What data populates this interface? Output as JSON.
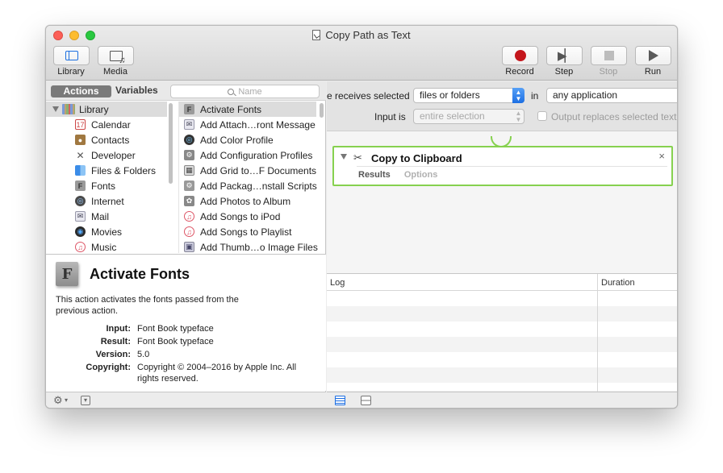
{
  "window": {
    "title": "Copy Path as Text"
  },
  "toolbar": {
    "library": "Library",
    "media": "Media",
    "record": "Record",
    "step": "Step",
    "stop": "Stop",
    "run": "Run"
  },
  "library_header": {
    "actions_tab": "Actions",
    "variables_tab": "Variables",
    "search_placeholder": "Name"
  },
  "categories": [
    {
      "label": "Library",
      "icon": "library-icon"
    },
    {
      "label": "Calendar",
      "icon": "calendar-icon"
    },
    {
      "label": "Contacts",
      "icon": "contacts-icon"
    },
    {
      "label": "Developer",
      "icon": "developer-icon"
    },
    {
      "label": "Files & Folders",
      "icon": "finder-icon"
    },
    {
      "label": "Fonts",
      "icon": "fonts-icon"
    },
    {
      "label": "Internet",
      "icon": "internet-icon"
    },
    {
      "label": "Mail",
      "icon": "mail-icon"
    },
    {
      "label": "Movies",
      "icon": "movies-icon"
    },
    {
      "label": "Music",
      "icon": "music-icon"
    }
  ],
  "actions": [
    {
      "label": "Activate Fonts",
      "icon": "font-book-icon",
      "selected": true
    },
    {
      "label": "Add Attach…ront Message",
      "icon": "mail-icon"
    },
    {
      "label": "Add Color Profile",
      "icon": "color-profile-icon"
    },
    {
      "label": "Add Configuration Profiles",
      "icon": "configurator-icon"
    },
    {
      "label": "Add Grid to…F Documents",
      "icon": "pdf-grid-icon"
    },
    {
      "label": "Add Packag…nstall Scripts",
      "icon": "package-icon"
    },
    {
      "label": "Add Photos to Album",
      "icon": "photos-icon"
    },
    {
      "label": "Add Songs to iPod",
      "icon": "itunes-icon"
    },
    {
      "label": "Add Songs to Playlist",
      "icon": "itunes-icon"
    },
    {
      "label": "Add Thumb…o Image Files",
      "icon": "preview-icon"
    }
  ],
  "description": {
    "title": "Activate Fonts",
    "icon_letter": "F",
    "text": "This action activates the fonts passed from the previous action.",
    "rows": [
      {
        "key": "Input:",
        "value": "Font Book typeface"
      },
      {
        "key": "Result:",
        "value": "Font Book typeface"
      },
      {
        "key": "Version:",
        "value": "5.0"
      },
      {
        "key": "Copyright:",
        "value": "Copyright © 2004–2016 by Apple Inc. All rights reserved."
      }
    ]
  },
  "workflow": {
    "receives_label": "e receives selected",
    "receives_value": "files or folders",
    "in_label": "in",
    "app_value": "any application",
    "input_label": "Input is",
    "input_value": "entire selection",
    "output_replaces_label": "Output replaces selected text"
  },
  "action_box": {
    "title": "Copy to Clipboard",
    "close_glyph": "×",
    "tab_results": "Results",
    "tab_options": "Options"
  },
  "log": {
    "col_log": "Log",
    "col_duration": "Duration"
  },
  "colors": {
    "accent_blue": "#1d6fe3",
    "record_red": "#c4161c",
    "action_border_green": "#86d14f"
  }
}
